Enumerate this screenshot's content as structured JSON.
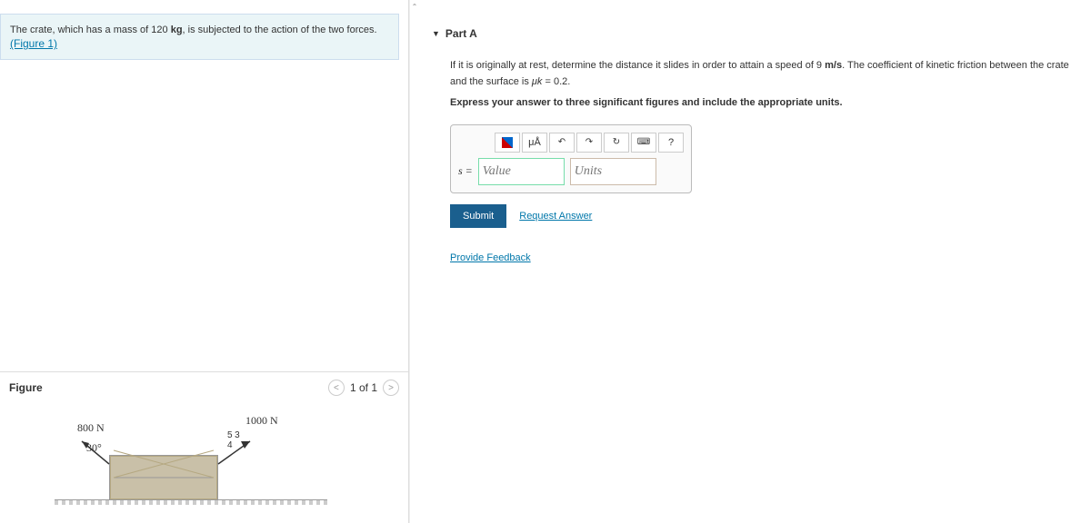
{
  "problem": {
    "text_before": "The crate, which has a mass of 120 ",
    "mass_unit": "kg",
    "text_after": ", is subjected to the action of the two forces.",
    "figure_link": "(Figure 1)"
  },
  "figure": {
    "title": "Figure",
    "pager": "1 of 1",
    "labels": {
      "force1": "800 N",
      "angle": "30°",
      "force2": "1000 N",
      "tri_h": "5",
      "tri_v": "3",
      "tri_b": "4"
    }
  },
  "part": {
    "title": "Part A",
    "q_before": "If it is originally at rest, determine the distance it slides in order to attain a speed of 9 ",
    "speed_unit": "m/s",
    "q_mid": ". The coefficient of kinetic friction between the crate and the surface is ",
    "muk_sym": "μk",
    "q_after": " = 0.2.",
    "instruction": "Express your answer to three significant figures and include the appropriate units.",
    "var": "s =",
    "value_ph": "Value",
    "units_ph": "Units",
    "toolbar": {
      "units_sym": "μÅ",
      "help": "?"
    },
    "submit": "Submit",
    "request": "Request Answer",
    "feedback": "Provide Feedback"
  }
}
